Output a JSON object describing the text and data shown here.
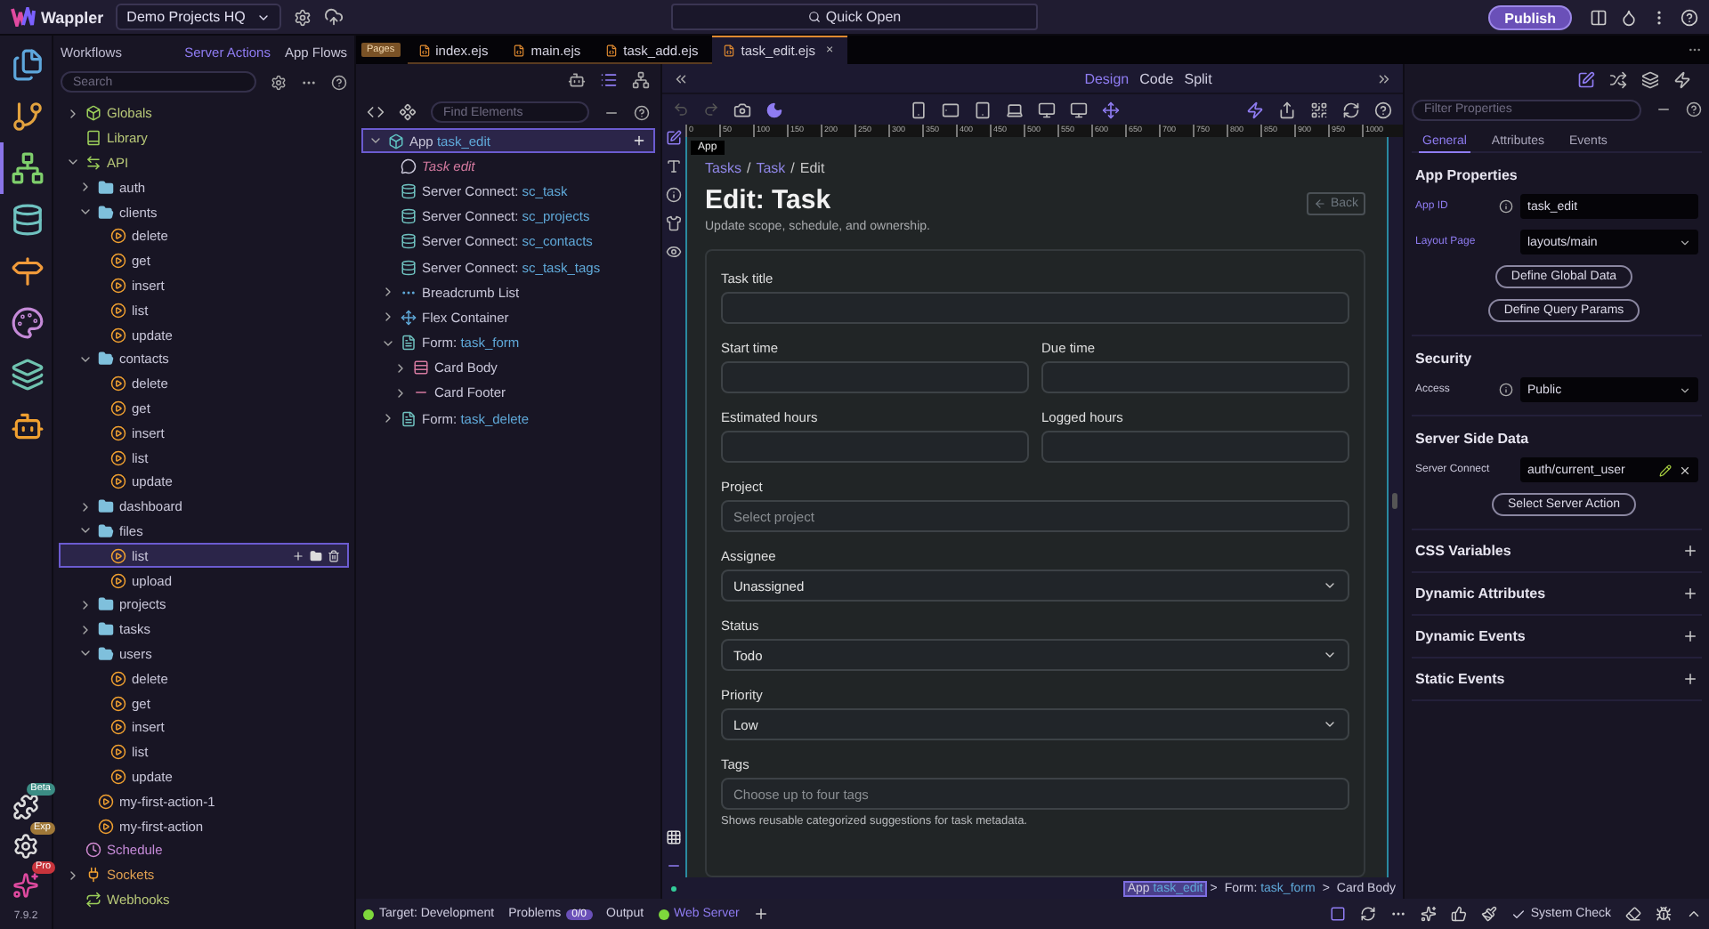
{
  "topbar": {
    "app_name": "Wappler",
    "project": "Demo Projects HQ",
    "quick_open": "Quick Open",
    "publish": "Publish"
  },
  "rail": {
    "items": [
      {
        "kind": "files",
        "selected": false
      },
      {
        "kind": "git",
        "selected": false
      },
      {
        "kind": "workflows",
        "selected": true
      },
      {
        "kind": "database",
        "selected": false
      },
      {
        "kind": "routing",
        "selected": false
      },
      {
        "kind": "design",
        "selected": false
      },
      {
        "kind": "layers",
        "selected": false
      },
      {
        "kind": "ai",
        "selected": false
      }
    ],
    "extras": [
      {
        "kind": "extensions",
        "badge": "Beta"
      },
      {
        "kind": "settings",
        "badge": "Exp"
      },
      {
        "kind": "brand",
        "badge": "Pro"
      }
    ],
    "version": "7.9.2"
  },
  "workflows_panel": {
    "title": "Workflows",
    "tabs": [
      {
        "label": "Server Actions",
        "selected": true
      },
      {
        "label": "App Flows",
        "selected": false
      }
    ],
    "search": {
      "placeholder": "Search"
    },
    "tree": [
      {
        "label": "Globals",
        "kind": "globals",
        "expanded": false,
        "selected": false
      },
      {
        "label": "Library",
        "kind": "library",
        "selected": false
      },
      {
        "label": "API",
        "kind": "api",
        "expanded": true,
        "selected": false,
        "children": [
          {
            "label": "auth",
            "kind": "folder",
            "expanded": false,
            "selected": false
          },
          {
            "label": "clients",
            "kind": "folder",
            "expanded": true,
            "selected": false,
            "children": [
              {
                "label": "delete",
                "kind": "action",
                "selected": false
              },
              {
                "label": "get",
                "kind": "action",
                "selected": false
              },
              {
                "label": "insert",
                "kind": "action",
                "selected": false
              },
              {
                "label": "list",
                "kind": "action",
                "selected": false
              },
              {
                "label": "update",
                "kind": "action",
                "selected": false
              }
            ]
          },
          {
            "label": "contacts",
            "kind": "folder",
            "expanded": true,
            "selected": false,
            "children": [
              {
                "label": "delete",
                "kind": "action",
                "selected": false
              },
              {
                "label": "get",
                "kind": "action",
                "selected": false
              },
              {
                "label": "insert",
                "kind": "action",
                "selected": false
              },
              {
                "label": "list",
                "kind": "action",
                "selected": false
              },
              {
                "label": "update",
                "kind": "action",
                "selected": false
              }
            ]
          },
          {
            "label": "dashboard",
            "kind": "folder",
            "expanded": false,
            "selected": false
          },
          {
            "label": "files",
            "kind": "folder",
            "expanded": true,
            "selected": false,
            "children": [
              {
                "label": "list",
                "kind": "action",
                "selected": true
              },
              {
                "label": "upload",
                "kind": "action",
                "selected": false
              }
            ]
          },
          {
            "label": "projects",
            "kind": "folder",
            "expanded": false,
            "selected": false
          },
          {
            "label": "tasks",
            "kind": "folder",
            "expanded": false,
            "selected": false
          },
          {
            "label": "users",
            "kind": "folder",
            "expanded": true,
            "selected": false,
            "children": [
              {
                "label": "delete",
                "kind": "action",
                "selected": false
              },
              {
                "label": "get",
                "kind": "action",
                "selected": false
              },
              {
                "label": "insert",
                "kind": "action",
                "selected": false
              },
              {
                "label": "list",
                "kind": "action",
                "selected": false
              },
              {
                "label": "update",
                "kind": "action",
                "selected": false
              }
            ]
          },
          {
            "label": "my-first-action-1",
            "kind": "action",
            "selected": false
          },
          {
            "label": "my-first-action",
            "kind": "action",
            "selected": false
          }
        ]
      },
      {
        "label": "Schedule",
        "kind": "schedule",
        "selected": false
      },
      {
        "label": "Sockets",
        "kind": "sockets",
        "expanded": false,
        "selected": false
      },
      {
        "label": "Webhooks",
        "kind": "webhooks",
        "selected": false
      }
    ]
  },
  "tabs": {
    "badge": "Pages",
    "items": [
      {
        "label": "index.ejs",
        "selected": false
      },
      {
        "label": "main.ejs",
        "selected": false
      },
      {
        "label": "task_add.ejs",
        "selected": false
      },
      {
        "label": "task_edit.ejs",
        "selected": true
      }
    ],
    "close": "×"
  },
  "elements_panel": {
    "search": {
      "placeholder": "Find Elements"
    },
    "tree": [
      {
        "label": "App",
        "name": "task_edit",
        "kind": "app",
        "expanded": true,
        "selected": true,
        "children": [
          {
            "label": "Task edit",
            "kind": "comment",
            "selected": false
          },
          {
            "label": "Server Connect:",
            "name": "sc_task",
            "kind": "server_connect",
            "selected": false
          },
          {
            "label": "Server Connect:",
            "name": "sc_projects",
            "kind": "server_connect",
            "selected": false
          },
          {
            "label": "Server Connect:",
            "name": "sc_contacts",
            "kind": "server_connect",
            "selected": false
          },
          {
            "label": "Server Connect:",
            "name": "sc_task_tags",
            "kind": "server_connect",
            "selected": false
          },
          {
            "label": "Breadcrumb List",
            "kind": "breadcrumb",
            "expanded": false,
            "selected": false
          },
          {
            "label": "Flex Container",
            "kind": "flex",
            "expanded": false,
            "selected": false
          },
          {
            "label": "Form:",
            "name": "task_form",
            "kind": "form",
            "expanded": true,
            "selected": false,
            "children": [
              {
                "label": "Card Body",
                "kind": "card_body",
                "expanded": false,
                "selected": false
              },
              {
                "label": "Card Footer",
                "kind": "card_footer",
                "expanded": false,
                "selected": false
              }
            ]
          },
          {
            "label": "Form:",
            "name": "task_delete",
            "kind": "form",
            "expanded": false,
            "selected": false
          }
        ]
      }
    ]
  },
  "canvas": {
    "view_modes": [
      {
        "label": "Design",
        "selected": true
      },
      {
        "label": "Code",
        "selected": false
      },
      {
        "label": "Split",
        "selected": false
      }
    ],
    "ruler": [
      "0",
      "50",
      "100",
      "150",
      "200",
      "250",
      "300",
      "350",
      "400",
      "450",
      "500",
      "550",
      "600",
      "650",
      "700",
      "750",
      "800",
      "850",
      "900",
      "950",
      "1000"
    ],
    "tooltip": "App",
    "page": {
      "breadcrumb": [
        "Tasks",
        "Task",
        "Edit"
      ],
      "separator": "/",
      "title": "Edit: Task",
      "subtitle": "Update scope, schedule, and ownership.",
      "back": "Back",
      "form": [
        {
          "fields": [
            {
              "label": "Task title",
              "kind": "input"
            }
          ]
        },
        {
          "fields": [
            {
              "label": "Start time",
              "kind": "input"
            },
            {
              "label": "Due time",
              "kind": "input"
            }
          ]
        },
        {
          "fields": [
            {
              "label": "Estimated hours",
              "kind": "input"
            },
            {
              "label": "Logged hours",
              "kind": "input"
            }
          ]
        },
        {
          "fields": [
            {
              "label": "Project",
              "kind": "input",
              "placeholder": "Select project"
            }
          ]
        },
        {
          "fields": [
            {
              "label": "Assignee",
              "kind": "select",
              "value": "Unassigned"
            }
          ]
        },
        {
          "fields": [
            {
              "label": "Status",
              "kind": "select",
              "value": "Todo"
            }
          ]
        },
        {
          "fields": [
            {
              "label": "Priority",
              "kind": "select",
              "value": "Low"
            }
          ]
        },
        {
          "fields": [
            {
              "label": "Tags",
              "kind": "input",
              "placeholder": "Choose up to four tags",
              "help": "Shows reusable categorized suggestions for task metadata."
            }
          ]
        }
      ]
    },
    "selection_path": {
      "separator": ">",
      "items": [
        {
          "label": "App",
          "name": "task_edit",
          "selected": true
        },
        {
          "label": "Form:",
          "name": "task_form",
          "selected": false
        },
        {
          "label": "Card Body",
          "selected": false
        }
      ]
    }
  },
  "properties": {
    "search": {
      "placeholder": "Filter Properties"
    },
    "tabs": [
      {
        "label": "General",
        "selected": true
      },
      {
        "label": "Attributes",
        "selected": false
      },
      {
        "label": "Events",
        "selected": false
      }
    ],
    "sections": [
      {
        "title": "App Properties",
        "expanded": true,
        "rows": [
          {
            "kind": "input",
            "label": "App ID",
            "value": "task_edit",
            "highlighted": true,
            "info": true
          },
          {
            "kind": "select",
            "label": "Layout Page",
            "value": "layouts/main",
            "highlighted": true,
            "info": false
          },
          {
            "kind": "button",
            "label": "Define Global Data"
          },
          {
            "kind": "button",
            "label": "Define Query Params"
          }
        ]
      },
      {
        "title": "Security",
        "expanded": true,
        "rows": [
          {
            "kind": "select",
            "label": "Access",
            "value": "Public",
            "highlighted": false,
            "info": true
          }
        ]
      },
      {
        "title": "Server Side Data",
        "expanded": true,
        "rows": [
          {
            "kind": "connect",
            "label": "Server Connect",
            "value": "auth/current_user",
            "highlighted": false,
            "info": false
          },
          {
            "kind": "button",
            "label": "Select Server Action"
          }
        ]
      },
      {
        "title": "CSS Variables",
        "expanded": false
      },
      {
        "title": "Dynamic Attributes",
        "expanded": false
      },
      {
        "title": "Dynamic Events",
        "expanded": false
      },
      {
        "title": "Static Events",
        "expanded": false
      }
    ]
  },
  "status_bar": {
    "target": "Target: Development",
    "problems": "Problems",
    "problems_count": "0/0",
    "output": "Output",
    "web_server": "Web Server",
    "system_check": "System Check"
  }
}
